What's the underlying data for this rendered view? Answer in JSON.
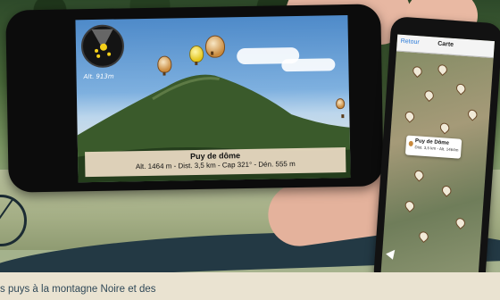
{
  "ar_view": {
    "altitude_label": "Alt. 913m",
    "summit_name": "Puy de dôme",
    "summit_details": "Alt. 1464 m - Dist. 3,5 km   - Cap 321° - Dén.  555 m"
  },
  "map_view": {
    "back_label": "Retour",
    "title": "Carte",
    "callout_title": "Puy de Dôme",
    "callout_subtitle": "Dist. 3,5 km - Alt. 1464m"
  },
  "caption": "s puys à la montagne Noire et des",
  "colors": {
    "road": "#233944",
    "caption_text": "#2f4858",
    "page_bg": "#eae3d1"
  }
}
